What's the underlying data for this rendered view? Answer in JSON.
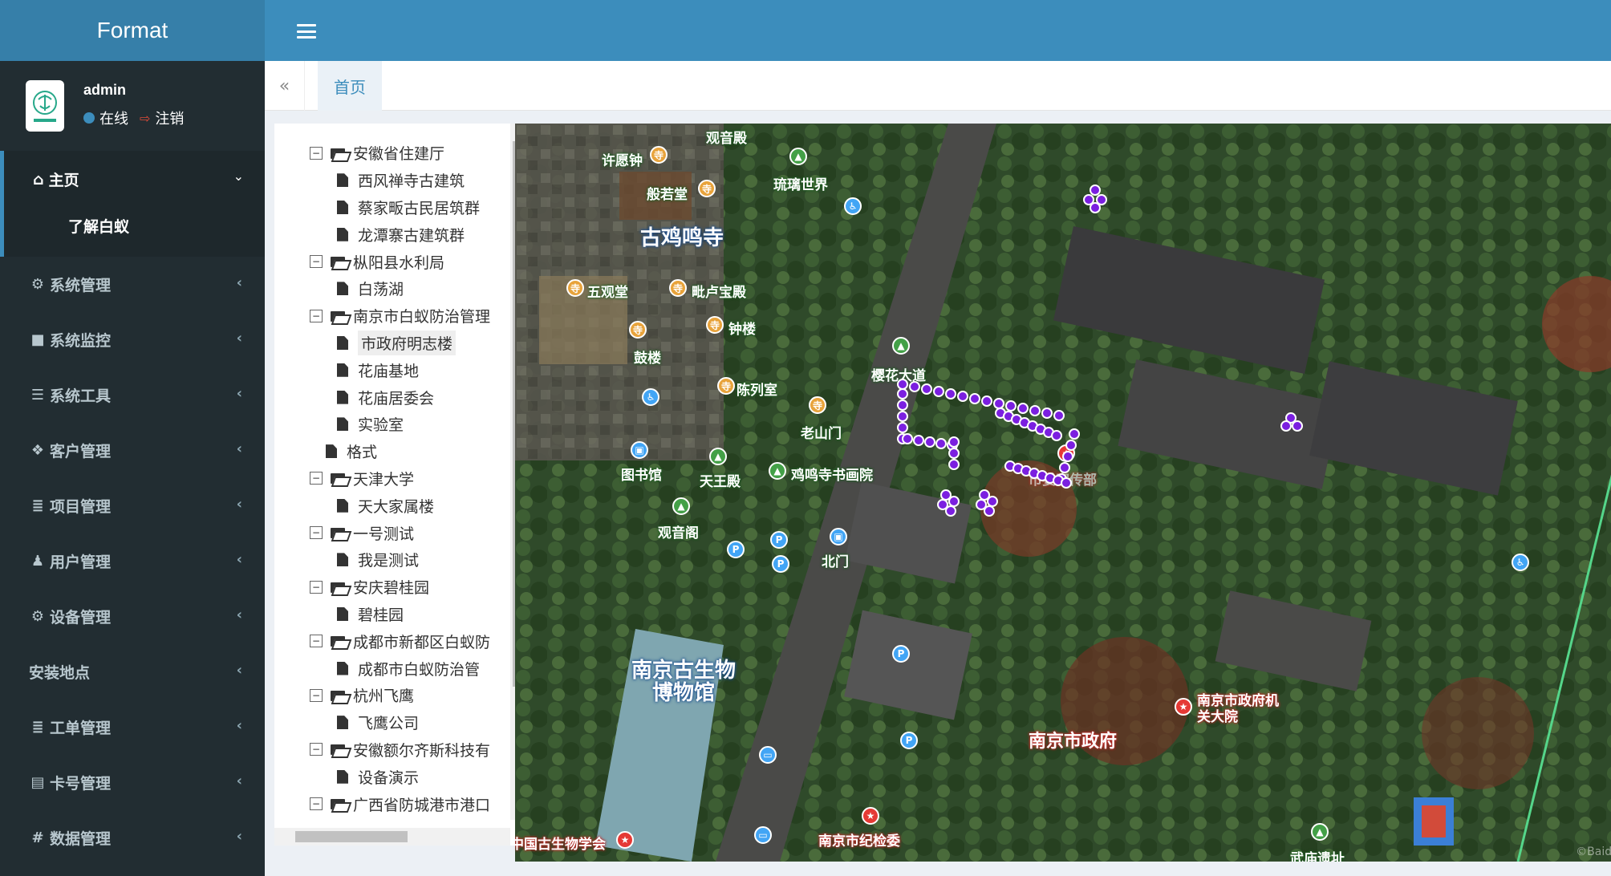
{
  "app": {
    "title": "Format"
  },
  "user": {
    "name": "admin",
    "status": "在线",
    "logout": "注销"
  },
  "sidebar": {
    "home": {
      "label": "主页",
      "sub": "了解白蚁"
    },
    "items": [
      {
        "label": "系统管理",
        "icon": "gear-icon",
        "glyph": "⚙"
      },
      {
        "label": "系统监控",
        "icon": "video-camera-icon",
        "glyph": "■"
      },
      {
        "label": "系统工具",
        "icon": "list-icon",
        "glyph": "☰"
      },
      {
        "label": "客户管理",
        "icon": "cubes-icon",
        "glyph": "❖"
      },
      {
        "label": "项目管理",
        "icon": "database-icon",
        "glyph": "≣"
      },
      {
        "label": "用户管理",
        "icon": "male-icon",
        "glyph": "♟"
      },
      {
        "label": "设备管理",
        "icon": "cogs-icon",
        "glyph": "⚙"
      },
      {
        "label": "安装地点",
        "icon": "",
        "glyph": ""
      },
      {
        "label": "工单管理",
        "icon": "database-icon",
        "glyph": "≣"
      },
      {
        "label": "卡号管理",
        "icon": "id-card-icon",
        "glyph": "▤"
      },
      {
        "label": "数据管理",
        "icon": "hashtag-icon",
        "glyph": "#"
      }
    ]
  },
  "tabs": {
    "home": "首页"
  },
  "tree": [
    {
      "label": "安徽省住建厅",
      "type": "folder"
    },
    {
      "label": "西风禅寺古建筑",
      "type": "file"
    },
    {
      "label": "蔡家畈古民居筑群",
      "type": "file"
    },
    {
      "label": "龙潭寨古建筑群",
      "type": "file"
    },
    {
      "label": "枞阳县水利局",
      "type": "folder"
    },
    {
      "label": "白荡湖",
      "type": "file"
    },
    {
      "label": "南京市白蚁防治管理",
      "type": "folder"
    },
    {
      "label": "市政府明志楼",
      "type": "file",
      "selected": true
    },
    {
      "label": "花庙基地",
      "type": "file"
    },
    {
      "label": "花庙居委会",
      "type": "file"
    },
    {
      "label": "实验室",
      "type": "file"
    },
    {
      "label": "格式",
      "type": "leaf"
    },
    {
      "label": "天津大学",
      "type": "folder"
    },
    {
      "label": "天大家属楼",
      "type": "file"
    },
    {
      "label": "一号测试",
      "type": "folder"
    },
    {
      "label": "我是测试",
      "type": "file"
    },
    {
      "label": "安庆碧桂园",
      "type": "folder"
    },
    {
      "label": "碧桂园",
      "type": "file"
    },
    {
      "label": "成都市新都区白蚁防",
      "type": "folder"
    },
    {
      "label": "成都市白蚁防治管",
      "type": "file"
    },
    {
      "label": "杭州飞鹰",
      "type": "folder"
    },
    {
      "label": "飞鹰公司",
      "type": "file"
    },
    {
      "label": "安徽额尔齐斯科技有",
      "type": "folder"
    },
    {
      "label": "设备演示",
      "type": "file"
    },
    {
      "label": "广西省防城港市港口",
      "type": "folder"
    }
  ],
  "map": {
    "labels": {
      "guanyin": "观音殿",
      "xuyuan": "许愿钟",
      "liuli": "琉璃世界",
      "banruo": "般若堂",
      "jimingsi": "古鸡鸣寺",
      "wuguan": "五观堂",
      "pilu": "毗卢宝殿",
      "gulou": "鼓楼",
      "zhonglou": "钟楼",
      "yinghua": "樱花大道",
      "chenlie": "陈列室",
      "laoshan": "老山门",
      "tushuguan": "图书馆",
      "tianwang": "天王殿",
      "shuhua": "鸡鸣寺书画院",
      "guanyinge": "观音阁",
      "beimen": "北门",
      "museum": "南京古生物博物馆",
      "zhengfu": "南京市政府",
      "jiguan": "南京市政府机关大院",
      "jijian": "南京市纪检委",
      "xuehui": "中国古生物学会",
      "wumiao": "武庙遗址",
      "xuanchuan": "市委宣传部"
    },
    "watermark": "©Baidu"
  }
}
